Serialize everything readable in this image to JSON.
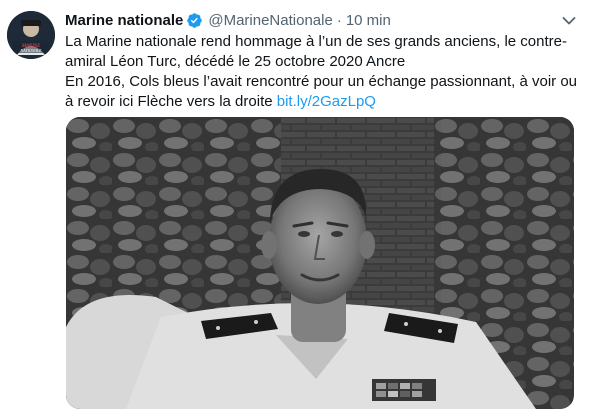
{
  "tweet": {
    "author": {
      "name": "Marine nationale",
      "handle": "@MarineNationale",
      "avatar_text": "MARINE NATIONALE",
      "verified": true
    },
    "timestamp": "10 min",
    "text_lines": [
      "La Marine nationale rend hommage à l’un de ses grands anciens, le contre-",
      "amiral Léon Turc, décédé le 25 octobre 2020 Ancre",
      "En 2016, Cols bleus l’avait rencontré pour un échange passionnant, à voir ou",
      "à revoir ici Flèche vers la droite "
    ],
    "link_text": "bit.ly/2GazLpQ",
    "media": {
      "type": "photo",
      "style": "black-and-white"
    }
  },
  "icons": {
    "verified": "verified-badge-icon",
    "caret": "chevron-down-icon"
  },
  "colors": {
    "link": "#1d9bf0",
    "text": "#0f1419",
    "secondary": "#536471"
  }
}
